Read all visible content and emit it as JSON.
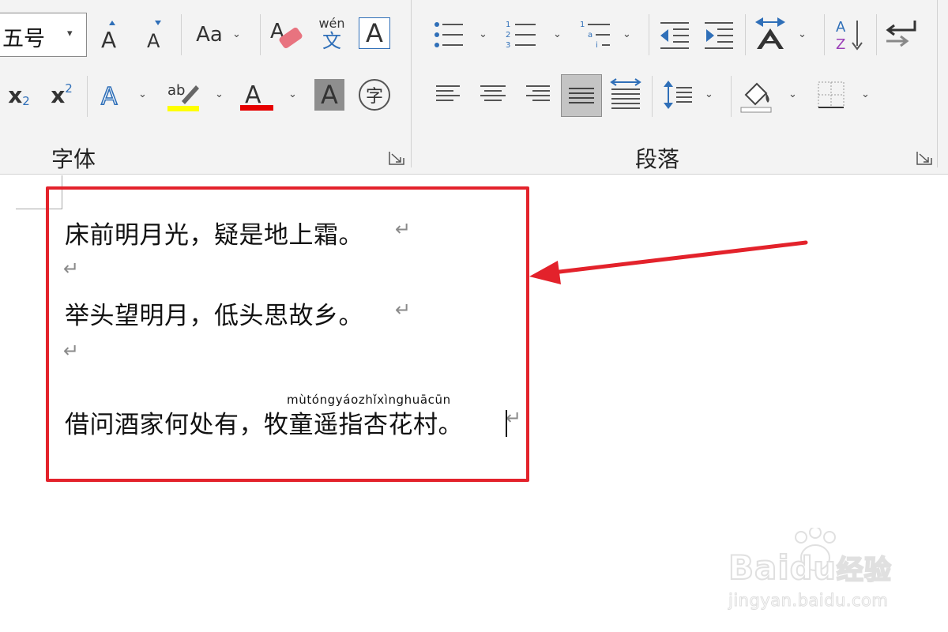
{
  "ribbon": {
    "font_group": {
      "label": "字体",
      "font_size": "五号",
      "change_case_label": "Aa",
      "phonetic_top": "wén",
      "phonetic_bottom": "文",
      "char_border_label": "A",
      "grow_font_label": "A",
      "shrink_font_label": "A",
      "subscript_label": "x",
      "subscript_mark": "2",
      "superscript_label": "x",
      "superscript_mark": "2",
      "text_effect_label": "A",
      "highlight_label": "ab",
      "font_color_label": "A",
      "shading_label": "A",
      "enclose_label": "字"
    },
    "paragraph_group": {
      "label": "段落",
      "sort_top": "A",
      "sort_bottom": "Z",
      "num_1": "1",
      "num_2": "2",
      "num_3": "3",
      "ml_1": "1",
      "ml_a": "a",
      "ml_i": "i"
    }
  },
  "document": {
    "lines": [
      "床前明月光，疑是地上霜。",
      "举头望明月，低头思故乡。",
      "借问酒家何处有，牧童遥指杏花村。"
    ],
    "pinyin_ruby": "mùtóngyáozhǐxìnghuācūn",
    "paragraph_mark": "↵"
  },
  "watermark": {
    "brand": "Bai",
    "brand_suffix": "经验",
    "url": "jingyan.baidu.com"
  },
  "colors": {
    "highlight_box": "#e3222b",
    "arrow": "#e3222b",
    "accent_blue": "#2f6fb8",
    "highlighter_yellow": "#ffff00",
    "font_red": "#e60000"
  }
}
